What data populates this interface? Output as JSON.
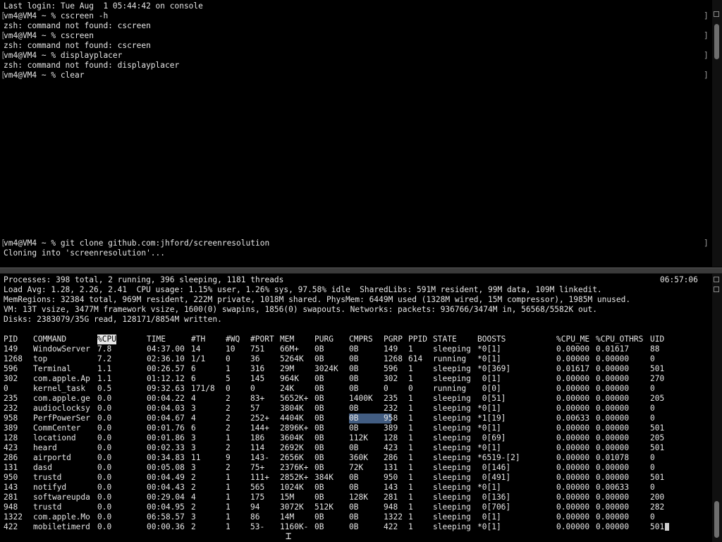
{
  "top_pane": {
    "lines": [
      {
        "prompt": false,
        "text": "Last login: Tue Aug  1 05:44:42 on console"
      },
      {
        "prompt": true,
        "text": "vm4@VM4 ~ % cscreen -h"
      },
      {
        "prompt": false,
        "text": "zsh: command not found: cscreen"
      },
      {
        "prompt": true,
        "text": "vm4@VM4 ~ % cscreen"
      },
      {
        "prompt": false,
        "text": "zsh: command not found: cscreen"
      },
      {
        "prompt": true,
        "text": "vm4@VM4 ~ % displayplacer"
      },
      {
        "prompt": false,
        "text": "zsh: command not found: displayplacer"
      },
      {
        "prompt": true,
        "text": "vm4@VM4 ~ % clear"
      }
    ],
    "bottom_lines": [
      {
        "prompt": true,
        "text": "vm4@VM4 ~ % git clone github.com:jhford/screenresolution"
      },
      {
        "prompt": false,
        "text": "Cloning into 'screenresolution'..."
      }
    ],
    "bracket_left": "[",
    "bracket_right": "]"
  },
  "top_output": {
    "clock": "06:57:06",
    "summary": [
      "Processes: 398 total, 2 running, 396 sleeping, 1181 threads",
      "Load Avg: 1.28, 2.26, 2.41  CPU usage: 1.15% user, 1.26% sys, 97.58% idle  SharedLibs: 591M resident, 99M data, 109M linkedit.",
      "MemRegions: 32384 total, 969M resident, 222M private, 1018M shared. PhysMem: 6449M used (1328M wired, 15M compressor), 1985M unused.",
      "VM: 13T vsize, 3477M framework vsize, 1600(0) swapins, 1856(0) swapouts. Networks: packets: 936766/3474M in, 56568/5582K out.",
      "Disks: 2383079/35G read, 128171/8854M written."
    ],
    "columns": [
      "PID",
      "COMMAND",
      "%CPU",
      "TIME",
      "#TH",
      "#WQ",
      "#PORT",
      "MEM",
      "PURG",
      "CMPRS",
      "PGRP",
      "PPID",
      "STATE",
      "BOOSTS",
      "%CPU_ME",
      "%CPU_OTHRS",
      "UID"
    ],
    "rows": [
      [
        "149",
        "WindowServer",
        "7.8",
        "04:37.00",
        "14",
        "10",
        "751",
        "66M+",
        "0B",
        "0B",
        "149",
        "1",
        "sleeping",
        "*0[1]",
        "0.00000",
        "0.01617",
        "88"
      ],
      [
        "1268",
        "top",
        "7.2",
        "02:36.10",
        "1/1",
        "0",
        "36",
        "5264K",
        "0B",
        "0B",
        "1268",
        "614",
        "running",
        "*0[1]",
        "0.00000",
        "0.00000",
        "0"
      ],
      [
        "596",
        "Terminal",
        "1.1",
        "00:26.57",
        "6",
        "1",
        "316",
        "29M",
        "3024K",
        "0B",
        "596",
        "1",
        "sleeping",
        "*0[369]",
        "0.01617",
        "0.00000",
        "501"
      ],
      [
        "302",
        "com.apple.Ap",
        "1.1",
        "01:12.12",
        "6",
        "5",
        "145",
        "964K",
        "0B",
        "0B",
        "302",
        "1",
        "sleeping",
        " 0[1]",
        "0.00000",
        "0.00000",
        "270"
      ],
      [
        "0",
        "kernel_task",
        "0.5",
        "09:32.63",
        "171/8",
        "0",
        "0",
        "24K",
        "0B",
        "0B",
        "0",
        "0",
        "running",
        " 0[0]",
        "0.00000",
        "0.00000",
        "0"
      ],
      [
        "235",
        "com.apple.ge",
        "0.0",
        "00:04.22",
        "4",
        "2",
        "83+",
        "5652K+",
        "0B",
        "1400K",
        "235",
        "1",
        "sleeping",
        " 0[51]",
        "0.00000",
        "0.00000",
        "205"
      ],
      [
        "232",
        "audioclocksy",
        "0.0",
        "00:04.03",
        "3",
        "2",
        "57",
        "3804K",
        "0B",
        "0B",
        "232",
        "1",
        "sleeping",
        "*0[1]",
        "0.00000",
        "0.00000",
        "0"
      ],
      [
        "958",
        "PerfPowerSer",
        "0.0",
        "00:04.67",
        "4",
        "2",
        "252+",
        "4404K",
        "0B",
        "0B",
        "958",
        "1",
        "sleeping",
        "*1[19]",
        "0.00633",
        "0.00000",
        "0"
      ],
      [
        "389",
        "CommCenter",
        "0.0",
        "00:01.76",
        "6",
        "2",
        "144+",
        "2896K+",
        "0B",
        "0B",
        "389",
        "1",
        "sleeping",
        "*0[1]",
        "0.00000",
        "0.00000",
        "501"
      ],
      [
        "128",
        "locationd",
        "0.0",
        "00:01.86",
        "3",
        "1",
        "186",
        "3604K",
        "0B",
        "112K",
        "128",
        "1",
        "sleeping",
        " 0[69]",
        "0.00000",
        "0.00000",
        "205"
      ],
      [
        "423",
        "heard",
        "0.0",
        "00:02.33",
        "3",
        "2",
        "114",
        "2692K",
        "0B",
        "0B",
        "423",
        "1",
        "sleeping",
        "*0[1]",
        "0.00000",
        "0.00000",
        "501"
      ],
      [
        "286",
        "airportd",
        "0.0",
        "00:34.83",
        "11",
        "9",
        "143-",
        "2656K",
        "0B",
        "360K",
        "286",
        "1",
        "sleeping",
        "*6519-[2]",
        "0.00000",
        "0.01078",
        "0"
      ],
      [
        "131",
        "dasd",
        "0.0",
        "00:05.08",
        "3",
        "2",
        "75+",
        "2376K+",
        "0B",
        "72K",
        "131",
        "1",
        "sleeping",
        " 0[146]",
        "0.00000",
        "0.00000",
        "0"
      ],
      [
        "950",
        "trustd",
        "0.0",
        "00:04.49",
        "2",
        "1",
        "111+",
        "2852K+",
        "384K",
        "0B",
        "950",
        "1",
        "sleeping",
        " 0[491]",
        "0.00000",
        "0.00000",
        "501"
      ],
      [
        "143",
        "notifyd",
        "0.0",
        "00:04.43",
        "2",
        "1",
        "565",
        "1024K",
        "0B",
        "0B",
        "143",
        "1",
        "sleeping",
        "*0[1]",
        "0.00000",
        "0.00633",
        "0"
      ],
      [
        "281",
        "softwareupda",
        "0.0",
        "00:29.04",
        "4",
        "1",
        "175",
        "15M",
        "0B",
        "128K",
        "281",
        "1",
        "sleeping",
        " 0[136]",
        "0.00000",
        "0.00000",
        "200"
      ],
      [
        "948",
        "trustd",
        "0.0",
        "00:04.95",
        "2",
        "1",
        "94",
        "3072K",
        "512K",
        "0B",
        "948",
        "1",
        "sleeping",
        " 0[706]",
        "0.00000",
        "0.00000",
        "282"
      ],
      [
        "1322",
        "com.apple.Mo",
        "0.0",
        "06:58.57",
        "3",
        "1",
        "86",
        "14M",
        "0B",
        "0B",
        "1322",
        "1",
        "sleeping",
        " 0[1]",
        "0.00000",
        "0.00000",
        "0"
      ],
      [
        "422",
        "mobiletimerd",
        "0.0",
        "00:00.36",
        "2",
        "1",
        "53-",
        "1160K-",
        "0B",
        "0B",
        "422",
        "1",
        "sleeping",
        "*0[1]",
        "0.00000",
        "0.00000",
        "501"
      ]
    ]
  }
}
